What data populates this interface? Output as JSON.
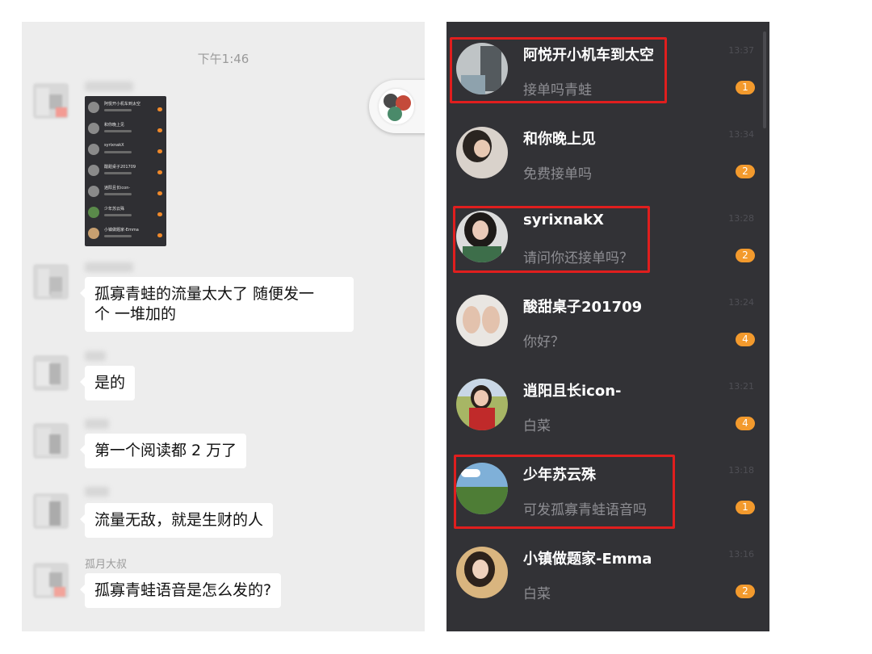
{
  "chat": {
    "timestamp": "下午1:46",
    "messages": [
      {
        "sender": "",
        "text": "孤寡青蛙的流量太大了  随便发一\n个  一堆加的"
      },
      {
        "sender": "",
        "text": "是的"
      },
      {
        "sender": "",
        "text": "第一个阅读都 2 万了"
      },
      {
        "sender": "",
        "text": "流量无敌，就是生财的人"
      },
      {
        "sender": "孤月大叔",
        "text": "孤寡青蛙语音是怎么发的?"
      }
    ],
    "screenshot_thumbnail": {
      "rows": [
        "阿悦开小机车到太空",
        "和你晚上见",
        "syrixnakX",
        "酸甜桌子201709",
        "逍阳且长icon-",
        "少年苏云殊",
        "小镇做题家-Emma"
      ]
    }
  },
  "conversations": [
    {
      "name": "阿悦开小机车到太空",
      "preview": "接单吗青蛙",
      "time": "13:37",
      "badge": "1",
      "highlighted": true
    },
    {
      "name": "和你晚上见",
      "preview": "免费接单吗",
      "time": "13:34",
      "badge": "2",
      "highlighted": false
    },
    {
      "name": "syrixnakX",
      "preview": "请问你还接单吗？",
      "time": "13:28",
      "badge": "2",
      "highlighted": true
    },
    {
      "name": "酸甜桌子201709",
      "preview": "你好？",
      "time": "13:24",
      "badge": "4",
      "highlighted": false
    },
    {
      "name": "逍阳且长icon-",
      "preview": "白菜",
      "time": "13:21",
      "badge": "4",
      "highlighted": false
    },
    {
      "name": "少年苏云殊",
      "preview": "可发孤寡青蛙语音吗",
      "time": "13:18",
      "badge": "1",
      "highlighted": true
    },
    {
      "name": "小镇做题家-Emma",
      "preview": "白菜",
      "time": "13:16",
      "badge": "2",
      "highlighted": false
    }
  ],
  "colors": {
    "highlight": "#e01e1e",
    "badge": "#f39a2d",
    "dark_panel": "#323236",
    "chat_bg": "#ededed"
  }
}
